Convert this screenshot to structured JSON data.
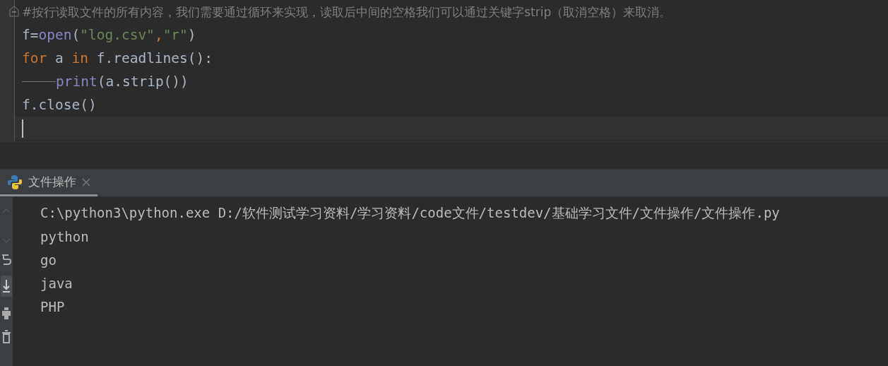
{
  "editor": {
    "lines": [
      {
        "indented": false,
        "current": false,
        "fold": true,
        "tokens": [
          {
            "kind": "comment",
            "text": "#按行读取文件的所有内容，我们需要通过循环来实现，读取后中间的空格我们可以通过关键字strip（取消空格）来取消。"
          }
        ]
      },
      {
        "indented": false,
        "current": false,
        "fold": false,
        "tokens": [
          {
            "kind": "plain",
            "text": "f="
          },
          {
            "kind": "builtin",
            "text": "open"
          },
          {
            "kind": "plain",
            "text": "("
          },
          {
            "kind": "string",
            "text": "\"log.csv\""
          },
          {
            "kind": "comma",
            "text": ","
          },
          {
            "kind": "string",
            "text": "\"r\""
          },
          {
            "kind": "plain",
            "text": ")"
          }
        ]
      },
      {
        "indented": false,
        "current": false,
        "fold": false,
        "tokens": [
          {
            "kind": "keyword",
            "text": "for"
          },
          {
            "kind": "plain",
            "text": " a "
          },
          {
            "kind": "keyword",
            "text": "in"
          },
          {
            "kind": "plain",
            "text": " f.readlines():"
          }
        ]
      },
      {
        "indented": true,
        "current": false,
        "fold": false,
        "tokens": [
          {
            "kind": "builtin",
            "text": "print"
          },
          {
            "kind": "plain",
            "text": "(a.strip())"
          }
        ]
      },
      {
        "indented": false,
        "current": false,
        "fold": false,
        "tokens": [
          {
            "kind": "plain",
            "text": "f.close()"
          }
        ]
      },
      {
        "indented": false,
        "current": true,
        "fold": false
      }
    ]
  },
  "run_panel": {
    "tabs": [
      {
        "label": "文件操作",
        "selected": true
      }
    ],
    "output": [
      "C:\\python3\\python.exe D:/软件测试学习资料/学习资料/code文件/testdev/基础学习文件/文件操作/文件操作.py",
      "python",
      "go",
      "java",
      "PHP"
    ]
  }
}
